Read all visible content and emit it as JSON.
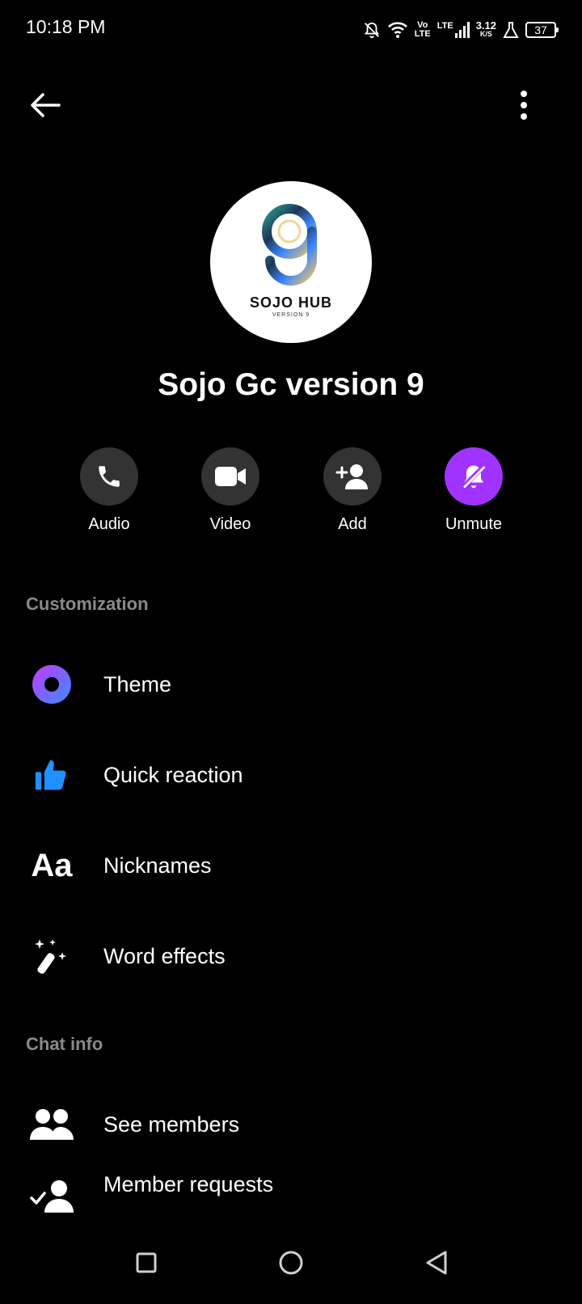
{
  "status_bar": {
    "time": "10:18 PM",
    "volte_top": "Vo",
    "volte_bottom": "LTE",
    "lte": "LTE",
    "speed_value": "3.12",
    "speed_unit": "K/S",
    "battery": "37"
  },
  "avatar": {
    "brand": "SOJO HUB",
    "subtitle": "VERSION 9"
  },
  "group": {
    "name": "Sojo Gc version 9"
  },
  "actions": [
    {
      "label": "Audio",
      "icon": "phone-icon"
    },
    {
      "label": "Video",
      "icon": "video-camera-icon"
    },
    {
      "label": "Add",
      "icon": "add-person-icon"
    },
    {
      "label": "Unmute",
      "icon": "bell-off-icon"
    }
  ],
  "sections": {
    "customization": "Customization",
    "chat_info": "Chat info"
  },
  "customization_items": [
    {
      "label": "Theme",
      "icon": "theme-icon"
    },
    {
      "label": "Quick reaction",
      "icon": "thumbs-up-icon"
    },
    {
      "label": "Nicknames",
      "icon": "text-aa-icon",
      "icon_text": "Aa"
    },
    {
      "label": "Word effects",
      "icon": "magic-wand-icon"
    }
  ],
  "chat_info_items": [
    {
      "label": "See members",
      "icon": "people-icon"
    },
    {
      "label": "Member requests",
      "icon": "member-requests-icon"
    }
  ],
  "colors": {
    "background": "#000000",
    "action_circle": "#333333",
    "accent_purple": "#a033ff",
    "section_title": "#8a8a8a",
    "thumbs_blue": "#1e90ff"
  }
}
